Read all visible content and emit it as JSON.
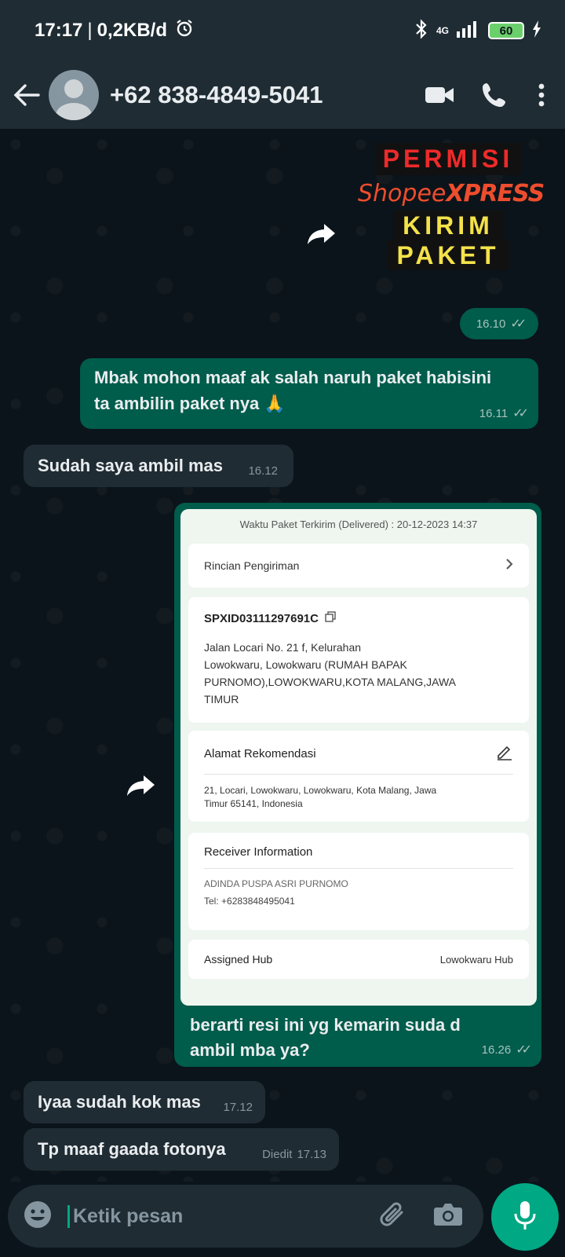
{
  "status_bar": {
    "time": "17:17",
    "separator": "|",
    "net_speed": "0,2KB/d",
    "network": "4G",
    "battery": "60"
  },
  "header": {
    "contact_name": "+62 838-4849-5041"
  },
  "messages": {
    "sticker": {
      "line1": "PERMISI",
      "brand_a": "Shopee",
      "brand_b": "XPRESS",
      "line3": "KIRIM",
      "line4": "PAKET",
      "time": "16.10"
    },
    "out_1": {
      "text_line1": "Mbak mohon maaf ak salah naruh paket habisini",
      "text_line2": "ta ambilin paket nya 🙏",
      "time": "16.11"
    },
    "in_1": {
      "text": "Sudah saya ambil mas",
      "time": "16.12"
    },
    "image_msg": {
      "caption_line1": "berarti resi ini yg kemarin suda d",
      "caption_line2": "ambil mba ya?",
      "time": "16.26"
    },
    "in_2": {
      "text": "Iyaa sudah kok mas",
      "time": "17.12"
    },
    "in_3": {
      "text": "Tp maaf gaada fotonya",
      "edited": "Diedit",
      "time": "17.13"
    }
  },
  "screenshot": {
    "delivered_time": "Waktu Paket Terkirim (Delivered) : 20-12-2023 14:37",
    "rincian_label": "Rincian Pengiriman",
    "tracking": "SPXID03111297691C",
    "address_l1": "Jalan Locari No. 21 f, Kelurahan",
    "address_l2": "Lowokwaru, Lowokwaru (RUMAH BAPAK",
    "address_l3": "PURNOMO),LOWOKWARU,KOTA MALANG,JAWA",
    "address_l4": "TIMUR",
    "rekomendasi_label": "Alamat Rekomendasi",
    "rekomendasi_l1": "21, Locari, Lowokwaru, Lowokwaru, Kota Malang, Jawa",
    "rekomendasi_l2": "Timur 65141, Indonesia",
    "receiver_label": "Receiver Information",
    "receiver_name": "ADINDA PUSPA ASRI PURNOMO",
    "receiver_tel": "Tel: +6283848495041",
    "hub_label": "Assigned Hub",
    "hub_value": "Lowokwaru Hub"
  },
  "input": {
    "placeholder": "Ketik pesan"
  },
  "colors": {
    "outgoing_bubble": "#005c4b",
    "incoming_bubble": "#202c33",
    "accent": "#00a884",
    "background": "#0b141a"
  }
}
